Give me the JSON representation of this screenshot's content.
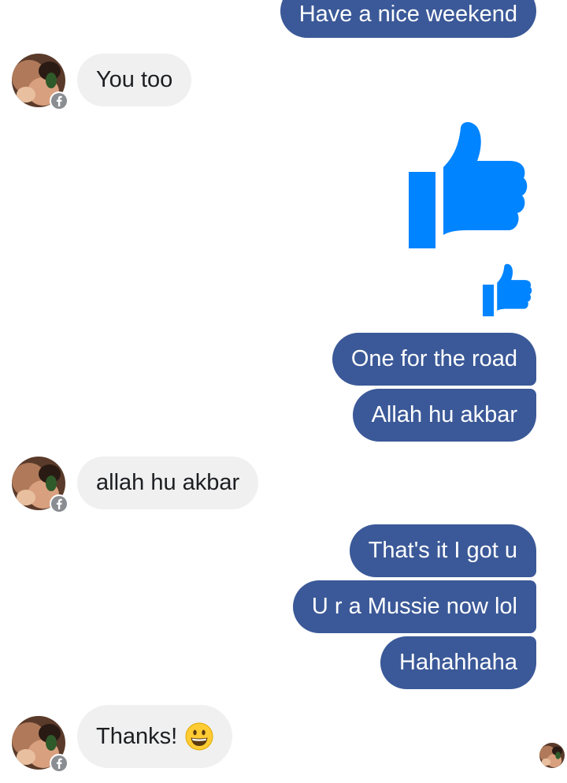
{
  "conversation": {
    "messages": [
      {
        "from": "me",
        "text": "Have a nice weekend"
      },
      {
        "from": "them",
        "text": "You too"
      },
      {
        "from": "me",
        "kind": "like",
        "size": "large"
      },
      {
        "from": "me",
        "kind": "like",
        "size": "small"
      },
      {
        "from": "me",
        "text": "One for the road"
      },
      {
        "from": "me",
        "text": "Allah hu akbar"
      },
      {
        "from": "them",
        "text": "allah hu akbar"
      },
      {
        "from": "me",
        "text": "That's it I got u"
      },
      {
        "from": "me",
        "text": "U r a Mussie now lol"
      },
      {
        "from": "me",
        "text": "Hahahhaha"
      },
      {
        "from": "them",
        "text": "Thanks!",
        "emoji": "grinning-face"
      }
    ]
  },
  "colors": {
    "outgoing_bubble": "#3b5998",
    "incoming_bubble": "#f0f0f0",
    "like_icon": "#0084ff"
  },
  "icons": {
    "like": "thumbs-up-icon",
    "badge": "facebook-badge-icon",
    "emoji": "grinning-face-emoji"
  }
}
